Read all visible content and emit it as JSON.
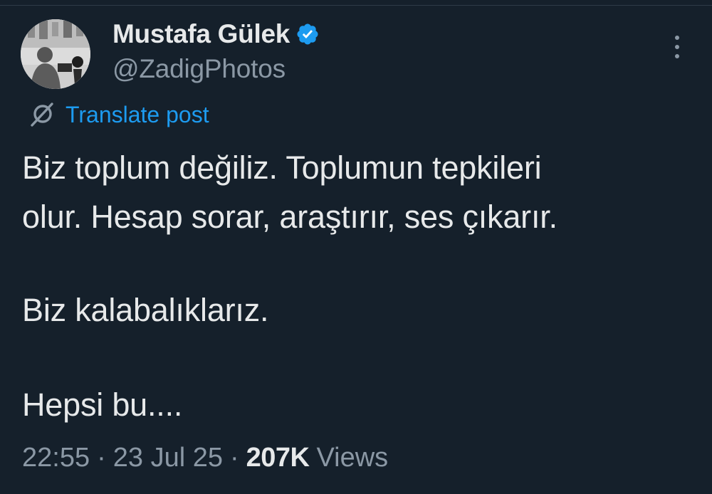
{
  "author": {
    "display_name": "Mustafa Gülek",
    "handle": "@ZadigPhotos",
    "verified_icon": "verified-badge-icon",
    "avatar_icon": "profile-photo"
  },
  "actions": {
    "more_icon": "more-options-icon",
    "translate_label": "Translate post",
    "translate_icon": "translate-globe-icon"
  },
  "tweet": {
    "lines": [
      "Biz toplum değiliz. Toplumun tepkileri",
      "olur. Hesap sorar, araştırır, ses çıkarır.",
      "Biz kalabalıklarız.",
      "Hepsi bu...."
    ]
  },
  "meta": {
    "time": "22:55",
    "separator": "·",
    "date": "23 Jul 25",
    "views_count": "207K",
    "views_label": "Views"
  },
  "colors": {
    "background": "#15202b",
    "text": "#e7e9ea",
    "secondary": "#8b98a5",
    "accent": "#1d9bf0"
  }
}
